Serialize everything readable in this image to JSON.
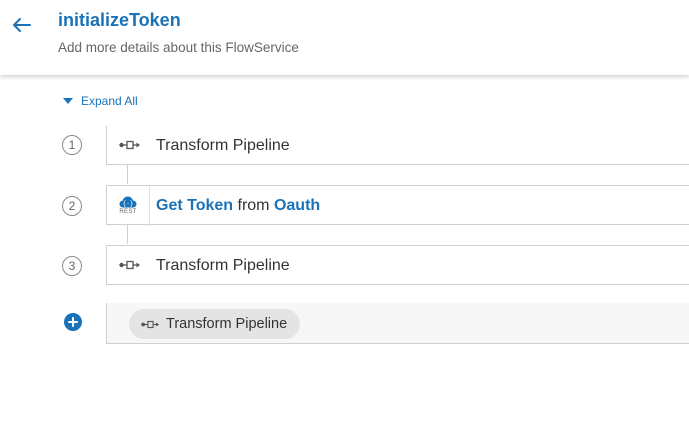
{
  "header": {
    "title": "initializeToken",
    "subtitle": "Add more details about this FlowService"
  },
  "toolbar": {
    "expand_all_label": "Expand All"
  },
  "steps": [
    {
      "number": "1",
      "label": "Transform Pipeline"
    },
    {
      "number": "2",
      "service": "Get Token",
      "connector_word": "from",
      "source": "Oauth",
      "badge": "REST"
    },
    {
      "number": "3",
      "label": "Transform Pipeline"
    }
  ],
  "suggestion": {
    "chip_label": "Transform Pipeline"
  },
  "colors": {
    "accent": "#1a73b8",
    "text": "#333333",
    "muted": "#666666",
    "border": "#cfcfcf"
  }
}
